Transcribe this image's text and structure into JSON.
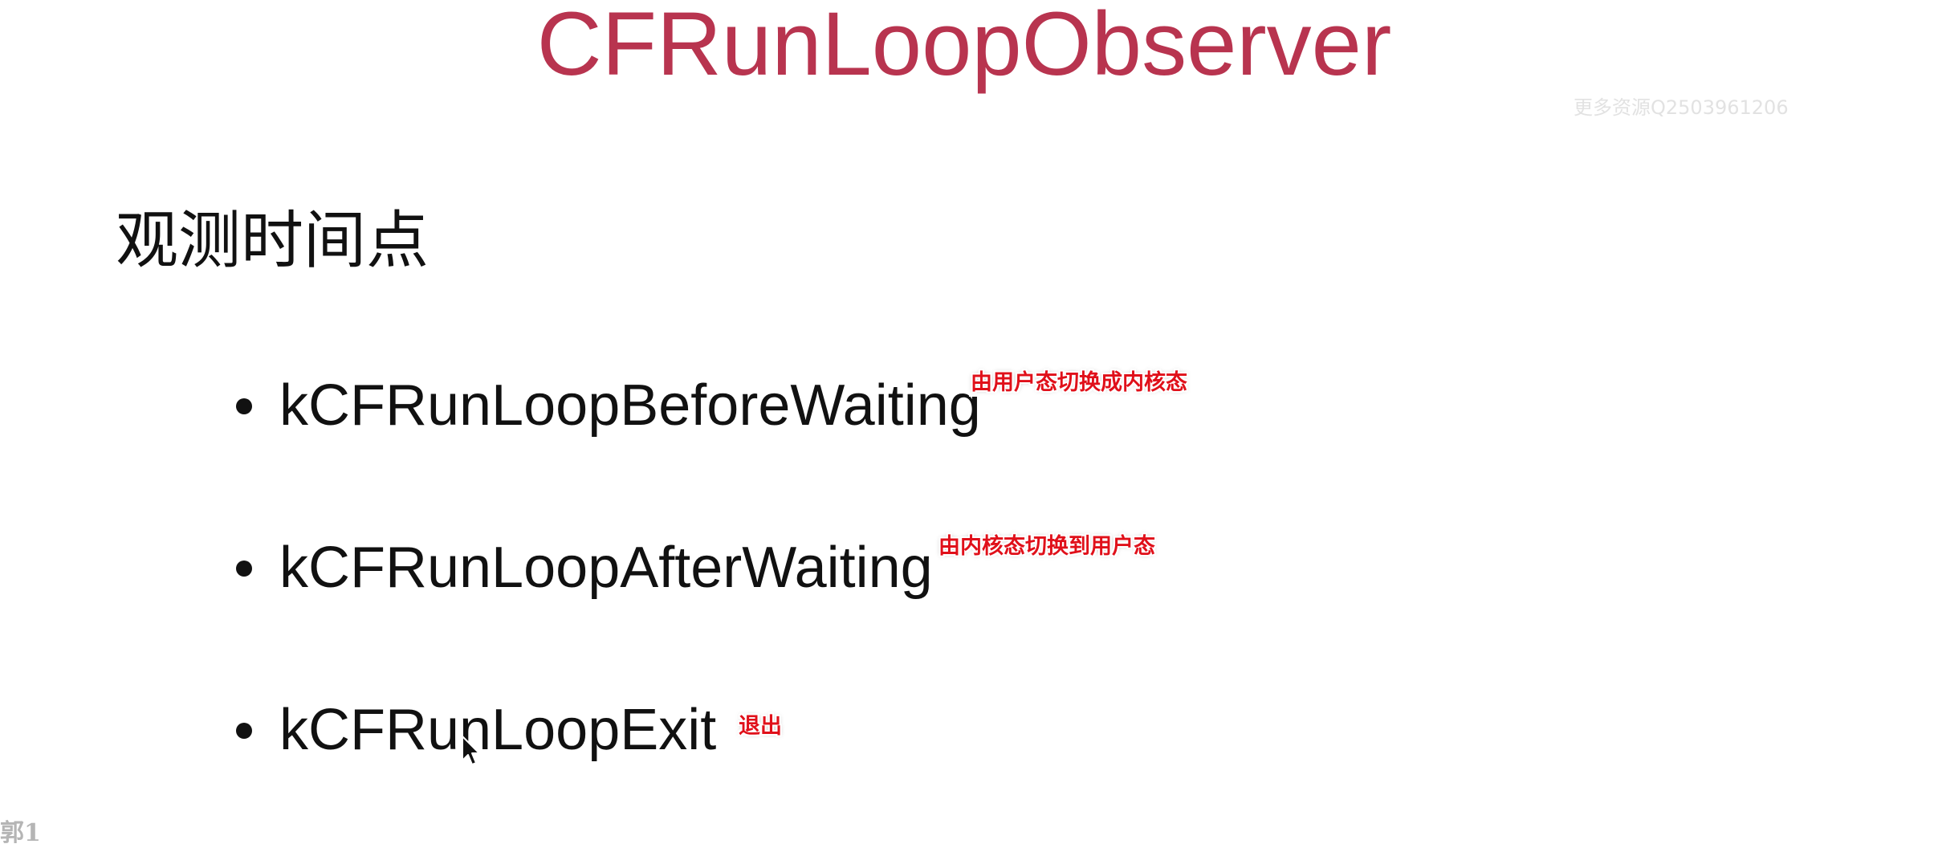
{
  "slide": {
    "title": "CFRunLoopObserver",
    "watermark": "更多资源Q2503961206",
    "subheading": "观测时间点",
    "bullets": [
      {
        "text": "kCFRunLoopBeforeWaiting",
        "annotation": "由用户态切换成内核态"
      },
      {
        "text": "kCFRunLoopAfterWaiting",
        "annotation": "由内核态切换到用户态"
      },
      {
        "text": "kCFRunLoopExit",
        "annotation": "退出"
      }
    ],
    "footer_mark": "郭1"
  },
  "colors": {
    "title": "#b8344f",
    "text": "#111111",
    "annotation": "#e0101a",
    "watermark": "#e2e2e2"
  },
  "icons": {
    "cursor": "mouse-pointer-icon"
  }
}
